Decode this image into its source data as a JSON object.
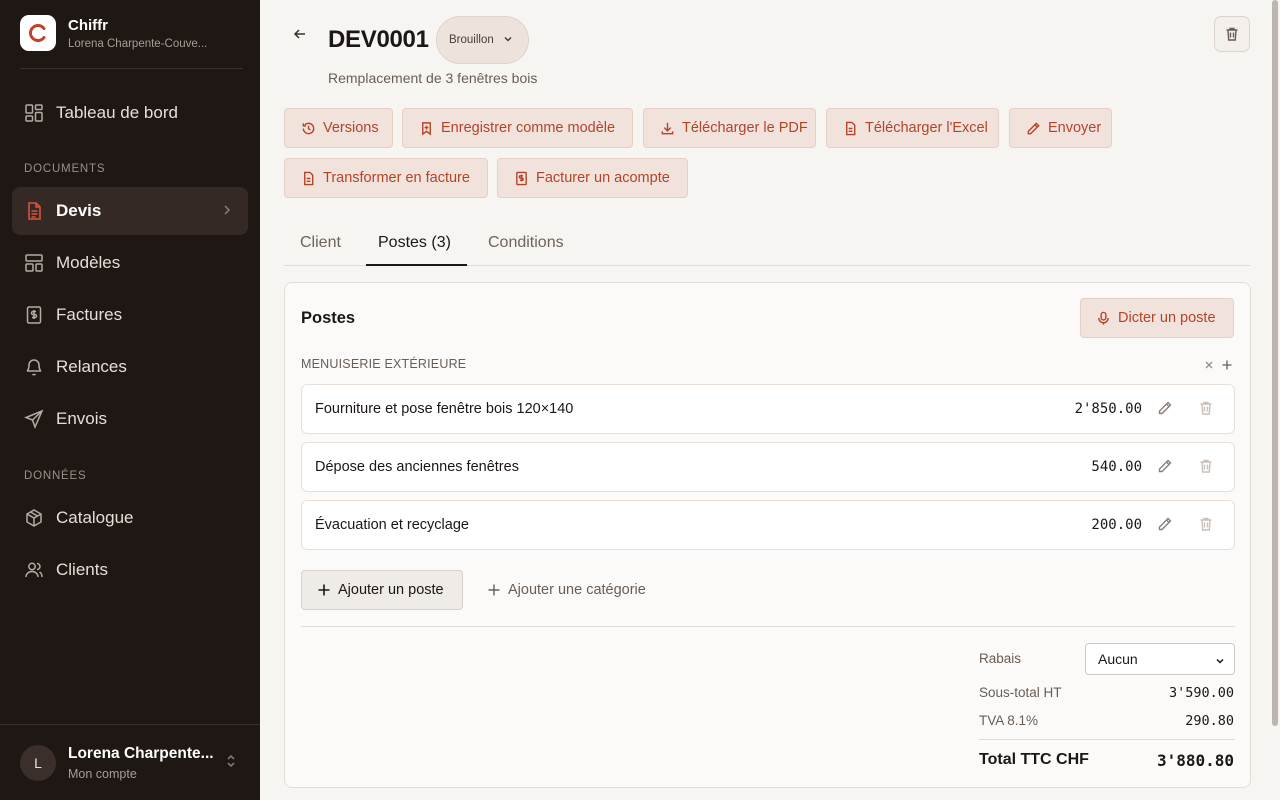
{
  "app": {
    "name": "Chiffr",
    "subtitle": "Lorena Charpente-Couve..."
  },
  "sidebar": {
    "dashboard": "Tableau de bord",
    "sections": {
      "documents": "DOCUMENTS",
      "data": "DONNÉES"
    },
    "items": [
      {
        "label": "Devis",
        "icon": "file-text-icon",
        "active": true
      },
      {
        "label": "Modèles",
        "icon": "layout-icon"
      },
      {
        "label": "Factures",
        "icon": "invoice-icon"
      },
      {
        "label": "Relances",
        "icon": "bell-icon"
      },
      {
        "label": "Envois",
        "icon": "send-icon"
      }
    ],
    "data_items": [
      {
        "label": "Catalogue",
        "icon": "package-icon"
      },
      {
        "label": "Clients",
        "icon": "users-icon"
      }
    ]
  },
  "user": {
    "initial": "L",
    "name": "Lorena Charpente...",
    "sub": "Mon compte"
  },
  "document": {
    "id": "DEV0001",
    "status": "Brouillon",
    "subtitle": "Remplacement de 3 fenêtres bois"
  },
  "actions": [
    {
      "label": "Versions",
      "icon": "history-icon"
    },
    {
      "label": "Enregistrer comme modèle",
      "icon": "bookmark-icon"
    },
    {
      "label": "Télécharger le PDF",
      "icon": "download-icon"
    },
    {
      "label": "Télécharger l'Excel",
      "icon": "file-icon"
    },
    {
      "label": "Envoyer",
      "icon": "pencil-icon"
    },
    {
      "label": "Transformer en facture",
      "icon": "file-icon"
    },
    {
      "label": "Facturer un acompte",
      "icon": "invoice-icon"
    }
  ],
  "tabs": [
    {
      "label": "Client"
    },
    {
      "label": "Postes (3)",
      "active": true
    },
    {
      "label": "Conditions"
    }
  ],
  "positions": {
    "title": "Postes",
    "dictate_label": "Dicter un poste",
    "category": "MENUISERIE EXTÉRIEURE",
    "rows": [
      {
        "description": "Fourniture et pose fenêtre bois 120×140",
        "amount": "2'850.00"
      },
      {
        "description": "Dépose des anciennes fenêtres",
        "amount": "540.00"
      },
      {
        "description": "Évacuation et recyclage",
        "amount": "200.00"
      }
    ],
    "add_position": "Ajouter un poste",
    "add_category": "Ajouter une catégorie"
  },
  "totals": {
    "discount_label": "Rabais",
    "discount_value": "Aucun",
    "subtotal_label": "Sous-total HT",
    "subtotal_value": "3'590.00",
    "vat_label": "TVA 8.1%",
    "vat_value": "290.80",
    "total_label": "Total TTC CHF",
    "total_value": "3'880.80"
  },
  "colors": {
    "accent": "#b3442a",
    "sidebar_bg": "#1f1714",
    "action_bg": "#f1e2dc"
  }
}
